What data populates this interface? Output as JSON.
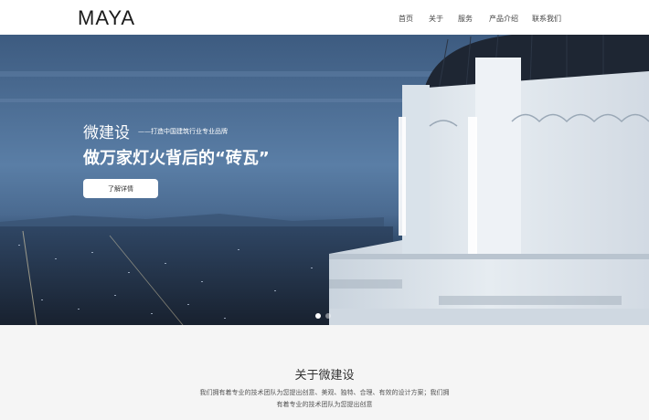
{
  "brand": {
    "logo": "MAYA"
  },
  "nav": {
    "items": [
      {
        "label": "首页"
      },
      {
        "label": "关于"
      },
      {
        "label": "服务"
      },
      {
        "label": "产品介绍"
      },
      {
        "label": "联系我们"
      }
    ]
  },
  "hero": {
    "title": "微建设",
    "subtitle": "——打造中国建筑行业专业品牌",
    "slogan": "做万家灯火背后的“砖瓦”",
    "button_label": "了解详情",
    "slides_total": 2,
    "active_slide": 1
  },
  "about": {
    "title": "关于微建设",
    "text_line1": "我们拥有着专业的技术团队为您提出创意、美观、独特、合理、有效的设计方案；我们拥",
    "text_line2": "有着专业的技术团队为您提出创意"
  },
  "colors": {
    "header_bg": "#ffffff",
    "hero_sky": "#4c6f96",
    "about_bg": "#f5f5f5",
    "text": "#333333"
  }
}
